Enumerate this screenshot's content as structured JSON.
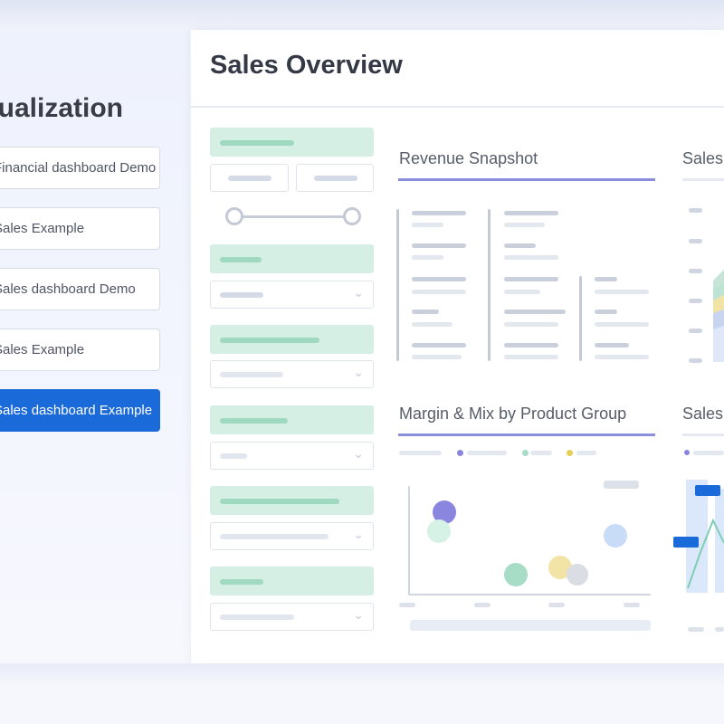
{
  "sidebar": {
    "title": "Visualization",
    "items": [
      {
        "label": "Financial dashboard Demo",
        "active": false
      },
      {
        "label": "Sales Example",
        "active": false
      },
      {
        "label": "Sales dashboard Demo",
        "active": false
      },
      {
        "label": "Sales Example",
        "active": false
      },
      {
        "label": "Sales dashboard Example",
        "active": true
      }
    ]
  },
  "main": {
    "title": "Sales Overview",
    "cards": [
      {
        "title": "Revenue Snapshot"
      },
      {
        "title": "Sales"
      },
      {
        "title": "Margin & Mix  by Product Group"
      },
      {
        "title": "Sales"
      }
    ]
  },
  "colors": {
    "accent": "#1a6ad9",
    "card_rule": "#8b8fdb",
    "filter_green": "#d6efe4",
    "bubble_purple": "#8a86e0",
    "bubble_mint": "#cfeee0",
    "bubble_teal": "#a7dcc7",
    "bubble_yellow": "#f2e3a6",
    "bubble_gray": "#dadde3",
    "bubble_blue": "#c8dcf8"
  },
  "icons": {
    "chevron": "chevron-down-icon",
    "chevron_glyph": "⌄"
  }
}
